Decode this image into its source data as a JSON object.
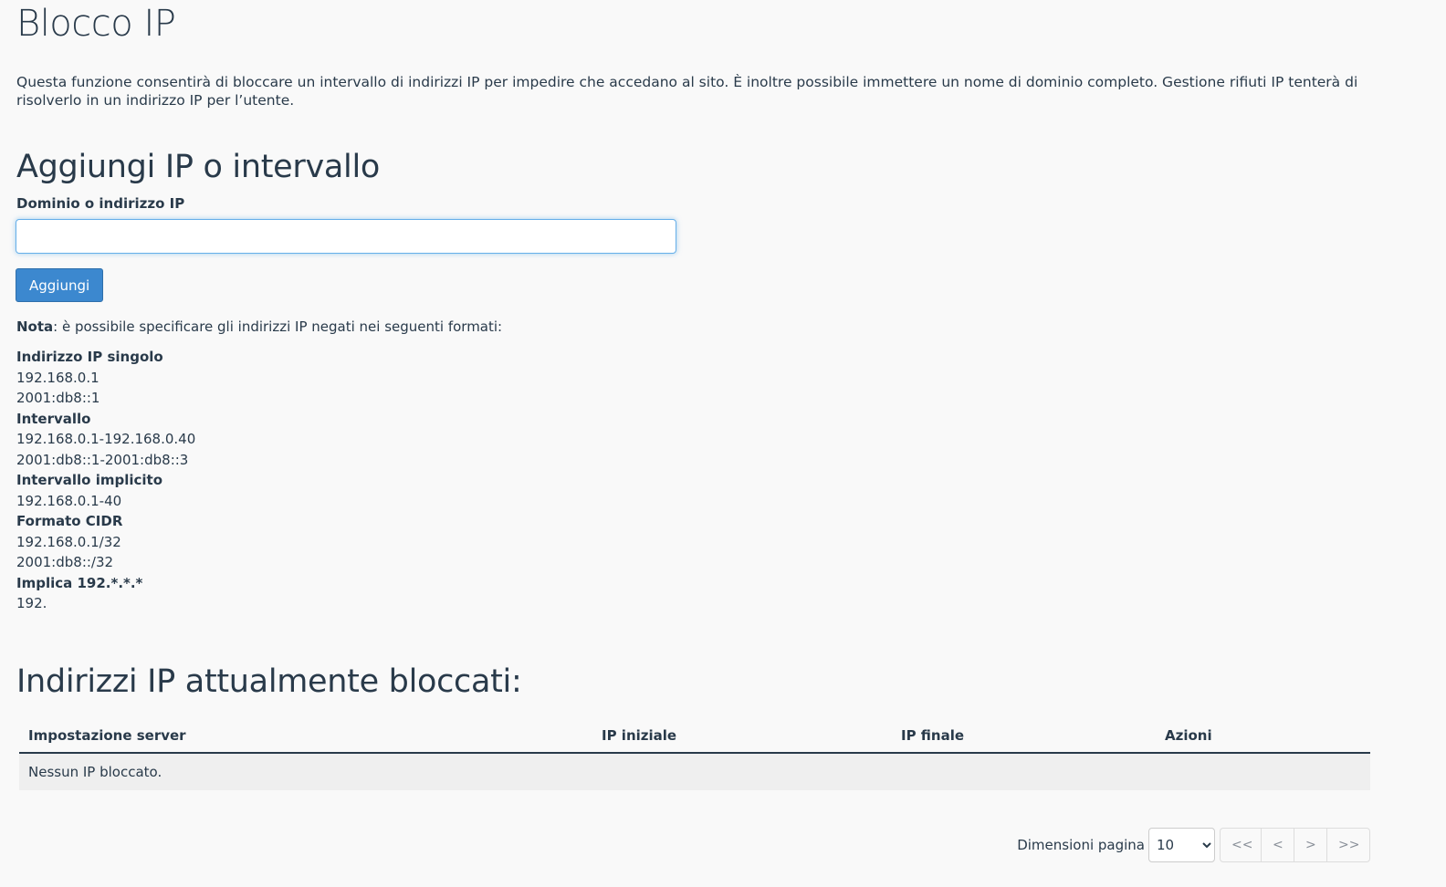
{
  "page": {
    "title": "Blocco IP",
    "description": "Questa funzione consentirà di bloccare un intervallo di indirizzi IP per impedire che accedano al sito. È inoltre possibile immettere un nome di dominio completo. Gestione rifiuti IP tenterà di risolverlo in un indirizzo IP per l’utente."
  },
  "add_section": {
    "title": "Aggiungi IP o intervallo",
    "field_label": "Dominio o indirizzo IP",
    "input_value": "",
    "button_label": "Aggiungi"
  },
  "note": {
    "bold": "Nota",
    "text": ": è possibile specificare gli indirizzi IP negati nei seguenti formati:"
  },
  "formats": [
    {
      "heading": "Indirizzo IP singolo",
      "examples": [
        "192.168.0.1",
        "2001:db8::1"
      ]
    },
    {
      "heading": "Intervallo",
      "examples": [
        "192.168.0.1-192.168.0.40",
        "2001:db8::1-2001:db8::3"
      ]
    },
    {
      "heading": "Intervallo implicito",
      "examples": [
        "192.168.0.1-40"
      ]
    },
    {
      "heading": "Formato CIDR",
      "examples": [
        "192.168.0.1/32",
        "2001:db8::/32"
      ]
    },
    {
      "heading": "Implica 192.*.*.*",
      "examples": [
        "192."
      ]
    }
  ],
  "blocked_section": {
    "title": "Indirizzi IP attualmente bloccati:",
    "columns": [
      "Impostazione server",
      "IP iniziale",
      "IP finale",
      "Azioni"
    ],
    "empty_message": "Nessun IP bloccato."
  },
  "pagination": {
    "label": "Dimensioni pagina",
    "page_size": "10",
    "first": "<<",
    "prev": "<",
    "next": ">",
    "last": ">>"
  },
  "colors": {
    "text": "#293a4a",
    "primary_button": "#3c88cf",
    "input_focus": "#66afe9",
    "background": "#f9f9f9"
  }
}
